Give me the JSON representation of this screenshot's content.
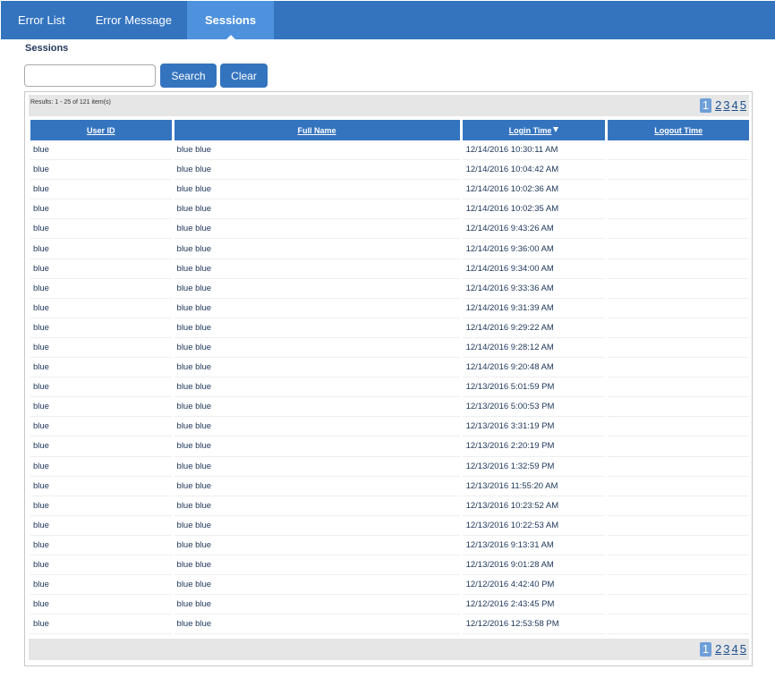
{
  "nav": {
    "tabs": [
      {
        "label": "Error List"
      },
      {
        "label": "Error Message"
      },
      {
        "label": "Sessions"
      }
    ],
    "active_index": 2
  },
  "page_title": "Sessions",
  "search": {
    "value": "",
    "placeholder": "",
    "search_label": "Search",
    "clear_label": "Clear"
  },
  "grid": {
    "results_text": "Results: 1 - 25 of 121 item(s)",
    "pages": [
      "1",
      "2",
      "3",
      "4",
      "5"
    ],
    "current_page": "1",
    "columns": [
      "User ID",
      "Full Name",
      "Login Time",
      "Logout Time"
    ],
    "sorted_column": "Login Time",
    "rows": [
      [
        "blue",
        "blue blue",
        "12/14/2016 10:30:11 AM",
        ""
      ],
      [
        "blue",
        "blue blue",
        "12/14/2016 10:04:42 AM",
        ""
      ],
      [
        "blue",
        "blue blue",
        "12/14/2016 10:02:36 AM",
        ""
      ],
      [
        "blue",
        "blue blue",
        "12/14/2016 10:02:35 AM",
        ""
      ],
      [
        "blue",
        "blue blue",
        "12/14/2016 9:43:26 AM",
        ""
      ],
      [
        "blue",
        "blue blue",
        "12/14/2016 9:36:00 AM",
        ""
      ],
      [
        "blue",
        "blue blue",
        "12/14/2016 9:34:00 AM",
        ""
      ],
      [
        "blue",
        "blue blue",
        "12/14/2016 9:33:36 AM",
        ""
      ],
      [
        "blue",
        "blue blue",
        "12/14/2016 9:31:39 AM",
        ""
      ],
      [
        "blue",
        "blue blue",
        "12/14/2016 9:29:22 AM",
        ""
      ],
      [
        "blue",
        "blue blue",
        "12/14/2016 9:28:12 AM",
        ""
      ],
      [
        "blue",
        "blue blue",
        "12/14/2016 9:20:48 AM",
        ""
      ],
      [
        "blue",
        "blue blue",
        "12/13/2016 5:01:59 PM",
        ""
      ],
      [
        "blue",
        "blue blue",
        "12/13/2016 5:00:53 PM",
        ""
      ],
      [
        "blue",
        "blue blue",
        "12/13/2016 3:31:19 PM",
        ""
      ],
      [
        "blue",
        "blue blue",
        "12/13/2016 2:20:19 PM",
        ""
      ],
      [
        "blue",
        "blue blue",
        "12/13/2016 1:32:59 PM",
        ""
      ],
      [
        "blue",
        "blue blue",
        "12/13/2016 11:55:20 AM",
        ""
      ],
      [
        "blue",
        "blue blue",
        "12/13/2016 10:23:52 AM",
        ""
      ],
      [
        "blue",
        "blue blue",
        "12/13/2016 10:22:53 AM",
        ""
      ],
      [
        "blue",
        "blue blue",
        "12/13/2016 9:13:31 AM",
        ""
      ],
      [
        "blue",
        "blue blue",
        "12/13/2016 9:01:28 AM",
        ""
      ],
      [
        "blue",
        "blue blue",
        "12/12/2016 4:42:40 PM",
        ""
      ],
      [
        "blue",
        "blue blue",
        "12/12/2016 2:43:45 PM",
        ""
      ],
      [
        "blue",
        "blue blue",
        "12/12/2016 12:53:58 PM",
        ""
      ]
    ]
  },
  "colors": {
    "accent": "#3474bf",
    "active_tab": "#4e92de",
    "pager_bg": "#e6e6e6"
  }
}
